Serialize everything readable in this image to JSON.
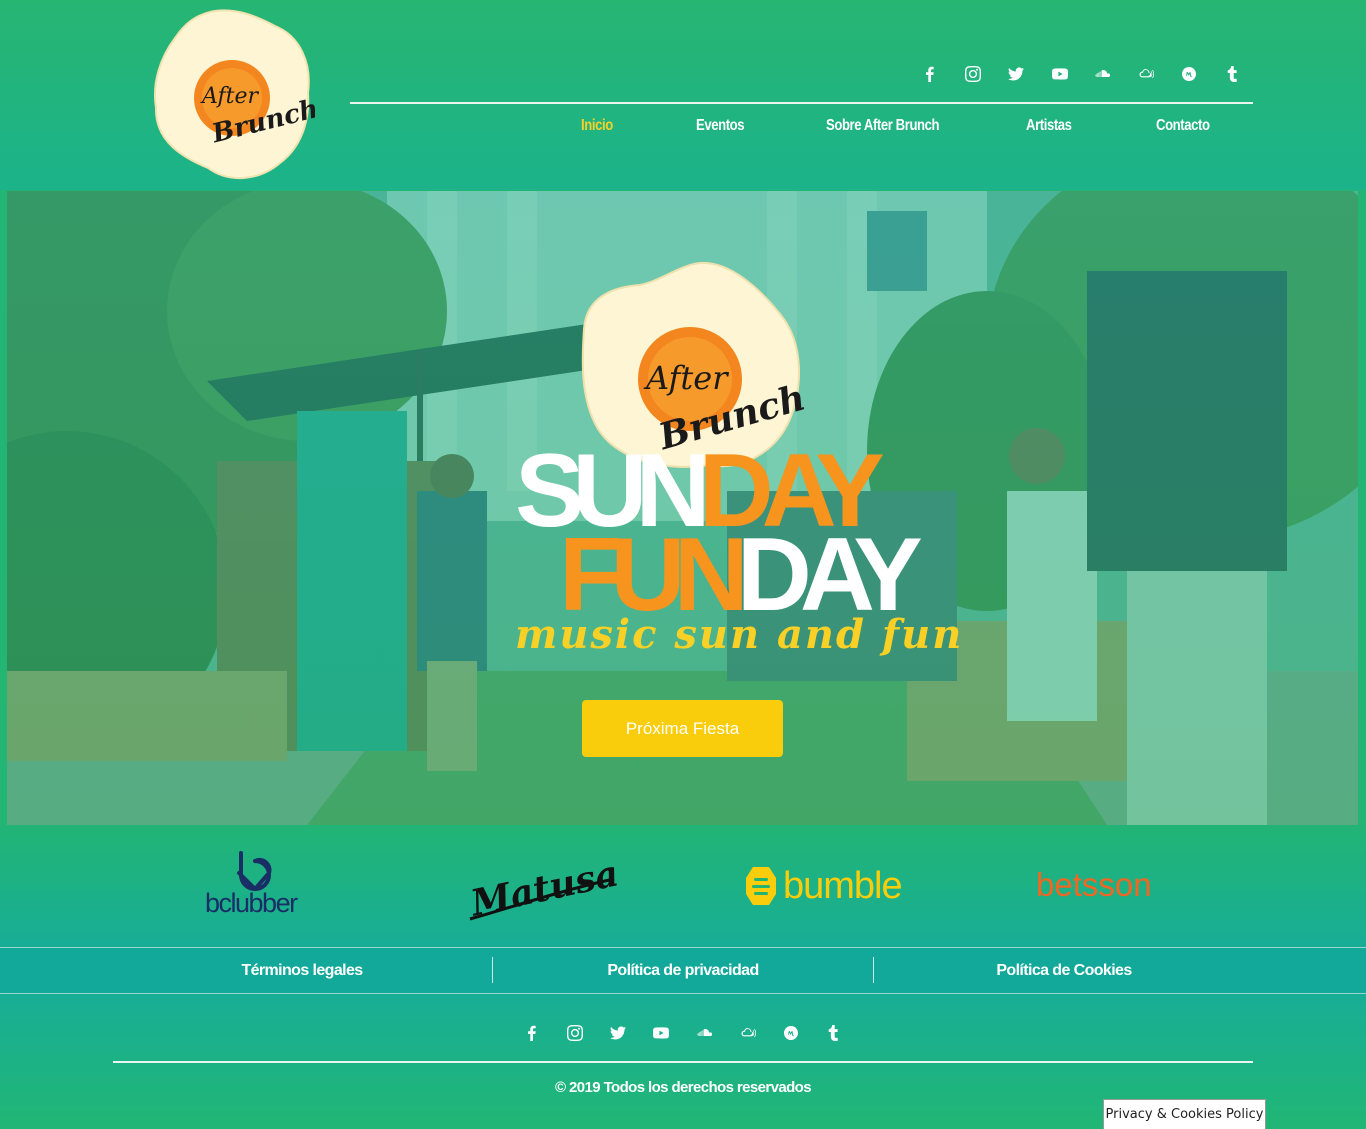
{
  "brand": {
    "logo_line1": "After",
    "logo_line2": "Brunch"
  },
  "social": [
    {
      "icon": "facebook-icon"
    },
    {
      "icon": "instagram-icon"
    },
    {
      "icon": "twitter-icon"
    },
    {
      "icon": "youtube-icon"
    },
    {
      "icon": "soundcloud-icon"
    },
    {
      "icon": "mixcloud-icon"
    },
    {
      "icon": "meetup-icon"
    },
    {
      "icon": "tumblr-icon"
    }
  ],
  "nav": {
    "items": [
      {
        "label": "Inicio",
        "active": true
      },
      {
        "label": "Eventos",
        "active": false
      },
      {
        "label": "Sobre After Brunch",
        "active": false
      },
      {
        "label": "Artistas",
        "active": false
      },
      {
        "label": "Contacto",
        "active": false
      }
    ]
  },
  "hero": {
    "sun": "SUN",
    "day1": "DAY",
    "fun": "FUN",
    "day2": "DAY",
    "tagline": "music sun and fun",
    "cta_label": "Próxima Fiesta"
  },
  "sponsors": {
    "bclubber": "bclubber",
    "matusalem": "Matusalem",
    "bumble": "bumble",
    "betsson": "betsson"
  },
  "legal": {
    "terms": "Términos legales",
    "privacy": "Política de privacidad",
    "cookies": "Política de Cookies"
  },
  "footer": {
    "copyright": "© 2019 Todos los derechos reservados",
    "cookie_button": "Privacy & Cookies Policy"
  },
  "colors": {
    "primary_green": "#22b574",
    "teal": "#12a89a",
    "accent_yellow": "#f9d126",
    "accent_orange": "#f7941d"
  }
}
